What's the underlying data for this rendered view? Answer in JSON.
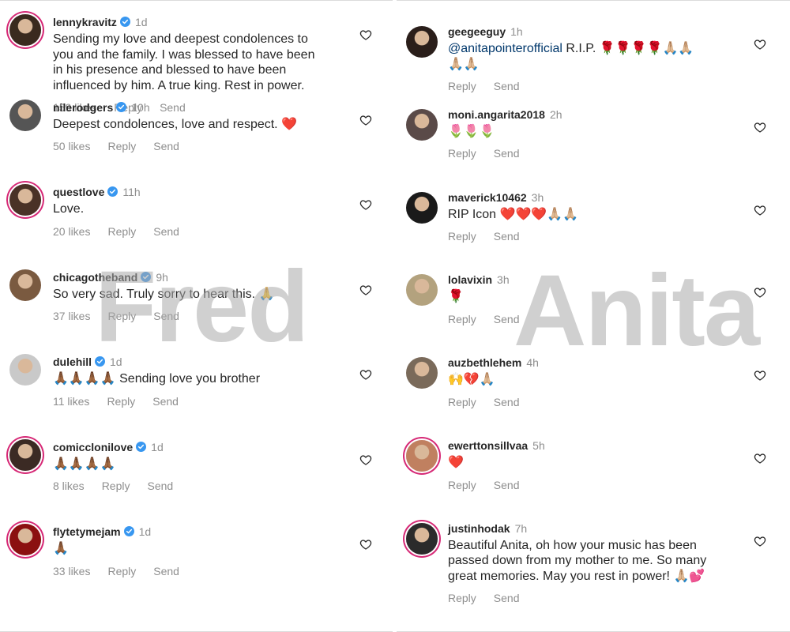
{
  "watermarks": {
    "left": "Fred",
    "right": "Anita"
  },
  "left_comments": [
    {
      "user": "lennykravitz",
      "verified": true,
      "time": "1d",
      "text": [
        "Sending my love and deepest condolences to",
        "you and the family. I was blessed to have been",
        "in his presence and blessed to have been",
        "influenced by him.  A true king. Rest in power."
      ],
      "likes": "159 likes",
      "reply": "Reply",
      "send": "Send"
    },
    {
      "user": "nilerodgers",
      "verified": true,
      "time": "10h",
      "text": [
        "Deepest condolences, love and respect. ❤️"
      ],
      "likes": "50 likes",
      "reply": "Reply",
      "send": "Send"
    },
    {
      "user": "questlove",
      "verified": true,
      "time": "11h",
      "text": [
        "Love."
      ],
      "likes": "20 likes",
      "reply": "Reply",
      "send": "Send"
    },
    {
      "user": "chicagotheband",
      "verified": true,
      "time": "9h",
      "text": [
        "So very sad. Truly sorry to hear this. 🙏"
      ],
      "likes": "37 likes",
      "reply": "Reply",
      "send": "Send"
    },
    {
      "user": "dulehill",
      "verified": true,
      "time": "1d",
      "text": [
        "🙏🏾🙏🏾🙏🏾🙏🏾 Sending love you brother"
      ],
      "likes": "11 likes",
      "reply": "Reply",
      "send": "Send"
    },
    {
      "user": "comicclonilove",
      "verified": true,
      "time": "1d",
      "text": [
        "🙏🏾🙏🏾🙏🏾🙏🏾"
      ],
      "likes": "8 likes",
      "reply": "Reply",
      "send": "Send"
    },
    {
      "user": "flytetymejam",
      "verified": true,
      "time": "1d",
      "text": [
        "🙏🏾"
      ],
      "likes": "33 likes",
      "reply": "Reply",
      "send": "Send"
    }
  ],
  "right_comments": [
    {
      "user": "geegeeguy",
      "verified": false,
      "time": "1h",
      "mention": "@anitapointerofficial",
      "text": [
        " R.I.P. 🌹🌹🌹🌹🙏🏼🙏🏼",
        "🙏🏼🙏🏼"
      ],
      "reply": "Reply",
      "send": "Send"
    },
    {
      "user": "moni.angarita2018",
      "verified": false,
      "time": "2h",
      "text": [
        "🌷🌷🌷"
      ],
      "reply": "Reply",
      "send": "Send"
    },
    {
      "user": "maverick10462",
      "verified": false,
      "time": "3h",
      "text": [
        "RIP Icon ❤️❤️❤️🙏🏼🙏🏼"
      ],
      "reply": "Reply",
      "send": "Send"
    },
    {
      "user": "lolavixin",
      "verified": false,
      "time": "3h",
      "text": [
        "🌹"
      ],
      "reply": "Reply",
      "send": "Send"
    },
    {
      "user": "auzbethlehem",
      "verified": false,
      "time": "4h",
      "text": [
        "🙌💔🙏🏼"
      ],
      "reply": "Reply",
      "send": "Send"
    },
    {
      "user": "ewerttonsillvaa",
      "verified": false,
      "time": "5h",
      "text": [
        "❤️"
      ],
      "reply": "Reply",
      "send": "Send"
    },
    {
      "user": "justinhodak",
      "verified": false,
      "time": "7h",
      "text": [
        "Beautiful Anita, oh how your music has been",
        "passed down from my mother to me. So many",
        "great memories. May you rest in power! 🙏🏼💕"
      ],
      "reply": "Reply",
      "send": "Send"
    }
  ],
  "colors": {
    "username": "#262626",
    "meta": "#8e8e8e",
    "mention": "#00376b",
    "verified": "#3897f0",
    "story_ring": "#d62976"
  },
  "icons": {
    "heart": "heart-outline-icon",
    "verified": "verified-badge-icon"
  }
}
